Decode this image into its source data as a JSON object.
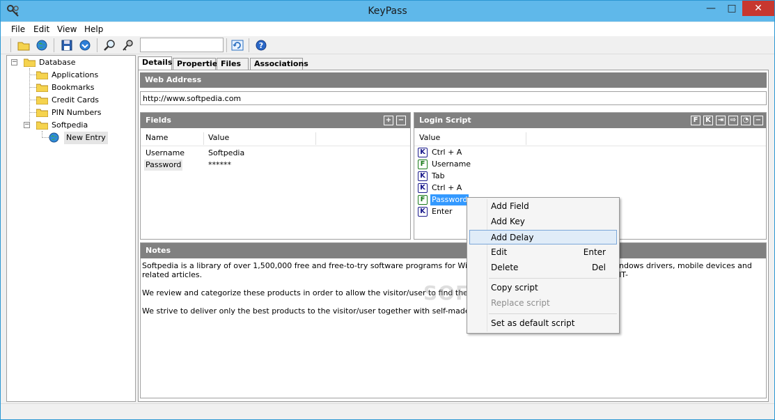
{
  "window": {
    "title": "KeyPass"
  },
  "menu": [
    "File",
    "Edit",
    "View",
    "Help"
  ],
  "toolbar": {
    "search_value": ""
  },
  "tree": {
    "root": "Database",
    "groups": [
      "Applications",
      "Bookmarks",
      "Credit Cards",
      "PIN Numbers",
      "Softpedia"
    ],
    "entry": "New Entry"
  },
  "tabs": [
    "Details",
    "Properties",
    "Files",
    "Associations"
  ],
  "web_address": {
    "header": "Web Address",
    "value": "http://www.softpedia.com"
  },
  "fields": {
    "header": "Fields",
    "columns": [
      "Name",
      "Value"
    ],
    "rows": [
      {
        "name": "Username",
        "value": "Softpedia"
      },
      {
        "name": "Password",
        "value": "******"
      }
    ]
  },
  "login_script": {
    "header": "Login Script",
    "column": "Value",
    "steps": [
      {
        "kind": "K",
        "text": "Ctrl + A"
      },
      {
        "kind": "F",
        "text": "Username"
      },
      {
        "kind": "K",
        "text": "Tab"
      },
      {
        "kind": "K",
        "text": "Ctrl + A"
      },
      {
        "kind": "F",
        "text": "Password"
      },
      {
        "kind": "K",
        "text": "Enter"
      }
    ]
  },
  "notes": {
    "header": "Notes",
    "paragraphs": [
      "Softpedia is a library of over 1,500,000 free and free-to-try software programs for Windows",
      "ndows drivers, mobile devices and IT-",
      "related articles.",
      "We review and categorize these products in order to allow the visitor/user to find the exac",
      "We strive to deliver only the best products to the visitor/user together with self-made evalu"
    ]
  },
  "context_menu": {
    "items": [
      {
        "label": "Add Field",
        "shortcut": ""
      },
      {
        "label": "Add Key",
        "shortcut": ""
      },
      {
        "label": "Add Delay",
        "shortcut": ""
      },
      {
        "label": "Edit",
        "shortcut": "Enter"
      },
      {
        "label": "Delete",
        "shortcut": "Del"
      },
      {
        "label": "Copy script",
        "shortcut": ""
      },
      {
        "label": "Replace script",
        "shortcut": ""
      },
      {
        "label": "Set as default script",
        "shortcut": ""
      }
    ]
  },
  "watermark": "SOFTPEDIA",
  "colors": {
    "header_gray": "#808080",
    "selection": "#3399ff",
    "title_bar": "#5fb8ea",
    "close": "#c7372f"
  }
}
